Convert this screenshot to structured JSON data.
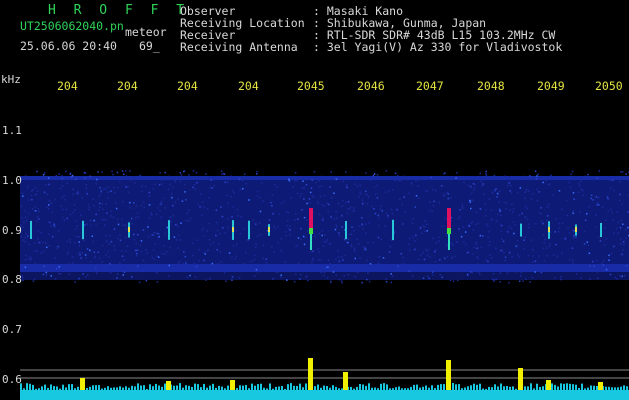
{
  "header": {
    "app_title": "H R O F F T",
    "filename": "UT2506062040.pn",
    "subtitle": "meteor",
    "datetime": "25.06.06 20:40",
    "count": "69_",
    "fields": [
      {
        "label": "Observer",
        "value": ": Masaki Kano"
      },
      {
        "label": "Receiving Location",
        "value": ": Shibukawa, Gunma, Japan"
      },
      {
        "label": "Receiver",
        "value": ": RTL-SDR SDR# 43dB L15 103.2MHz CW"
      },
      {
        "label": "Receiving Antenna",
        "value": ": 3el Yagi(V) Az 330 for Vladivostok"
      }
    ]
  },
  "axis": {
    "y_unit": "kHz",
    "y_ticks": [
      "1.1",
      "1.0",
      "0.9",
      "0.8",
      "0.7",
      "0.6"
    ],
    "x_ticks": [
      "204",
      "204",
      "204",
      "204",
      "2045",
      "2046",
      "2047",
      "2048",
      "2049",
      "2050"
    ]
  },
  "colors": {
    "header_green": "#2fd35a",
    "header_white": "#d8d8d8",
    "axis_yellow": "#e3e342",
    "spectrum_blue": "#1b2fb0",
    "power_cyan": "#18c8e0",
    "power_yellow": "#f0f000"
  }
}
